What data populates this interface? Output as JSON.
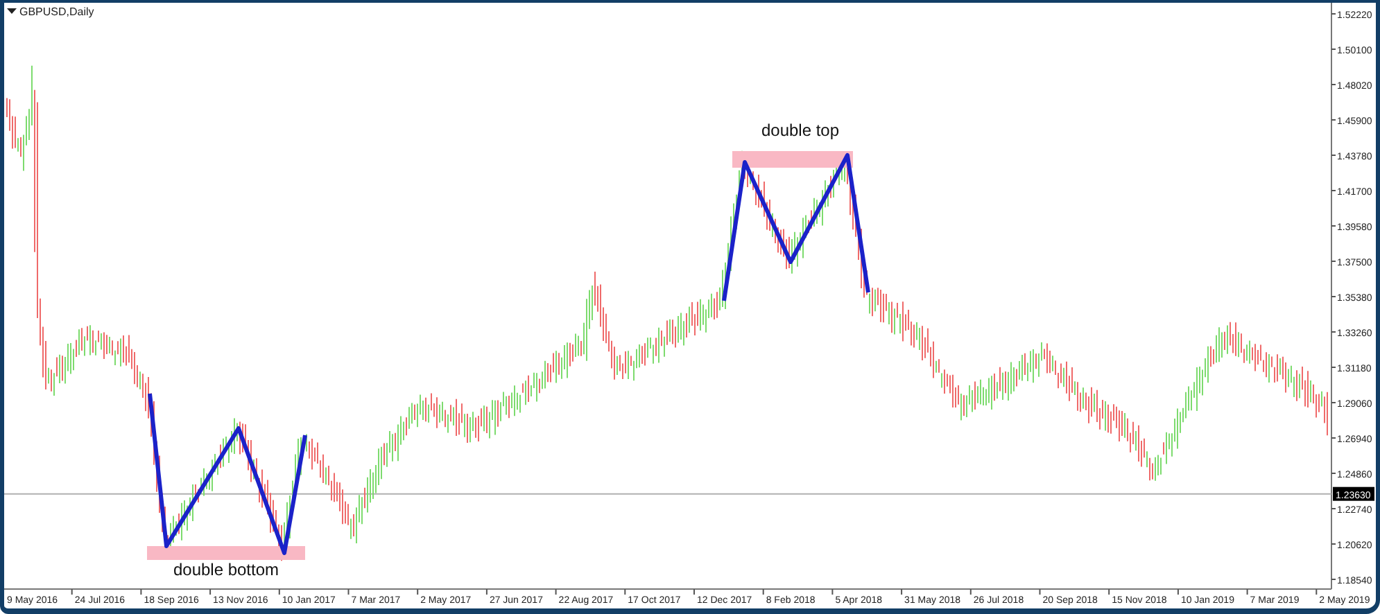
{
  "chart": {
    "title": "GBPUSD,Daily",
    "price_axis": [
      "1.52220",
      "1.50100",
      "1.48020",
      "1.45900",
      "1.43780",
      "1.41700",
      "1.39580",
      "1.37500",
      "1.35380",
      "1.33260",
      "1.31180",
      "1.29060",
      "1.26940",
      "1.24860",
      "1.22740",
      "1.20620",
      "1.18540"
    ],
    "current_price": "1.23630",
    "time_axis": [
      "9 May 2016",
      "24 Jul 2016",
      "18 Sep 2016",
      "13 Nov 2016",
      "10 Jan 2017",
      "7 Mar 2017",
      "2 May 2017",
      "27 Jun 2017",
      "22 Aug 2017",
      "17 Oct 2017",
      "12 Dec 2017",
      "8 Feb 2018",
      "5 Apr 2018",
      "31 May 2018",
      "26 Jul 2018",
      "20 Sep 2018",
      "15 Nov 2018",
      "10 Jan 2019",
      "7 Mar 2019",
      "2 May 2019"
    ],
    "annotations": [
      {
        "kind": "bottom",
        "label": "double bottom"
      },
      {
        "kind": "top",
        "label": "double top"
      }
    ]
  }
}
